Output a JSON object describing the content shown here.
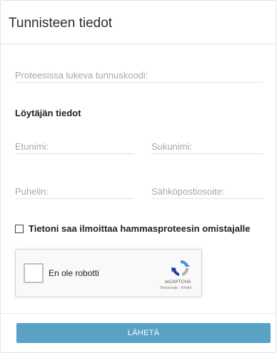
{
  "header": {
    "title": "Tunnisteen tiedot"
  },
  "fields": {
    "code_placeholder": "Proteesissa lukeva tunnuskoodi:",
    "firstname_placeholder": "Etunimi:",
    "lastname_placeholder": "Sukunimi:",
    "phone_placeholder": "Puhelin:",
    "email_placeholder": "Sähköpostiosoite:"
  },
  "finder_section": {
    "title": "Löytäjän tiedot"
  },
  "consent": {
    "label": "Tietoni saa ilmoittaa hammasproteesin omistajalle",
    "checked": false
  },
  "recaptcha": {
    "label": "En ole robotti",
    "brand": "reCAPTCHA",
    "terms": "Tietosuoja - Ehdot"
  },
  "actions": {
    "submit_label": "LÄHETÄ",
    "submit_color": "#5aa2c5"
  }
}
